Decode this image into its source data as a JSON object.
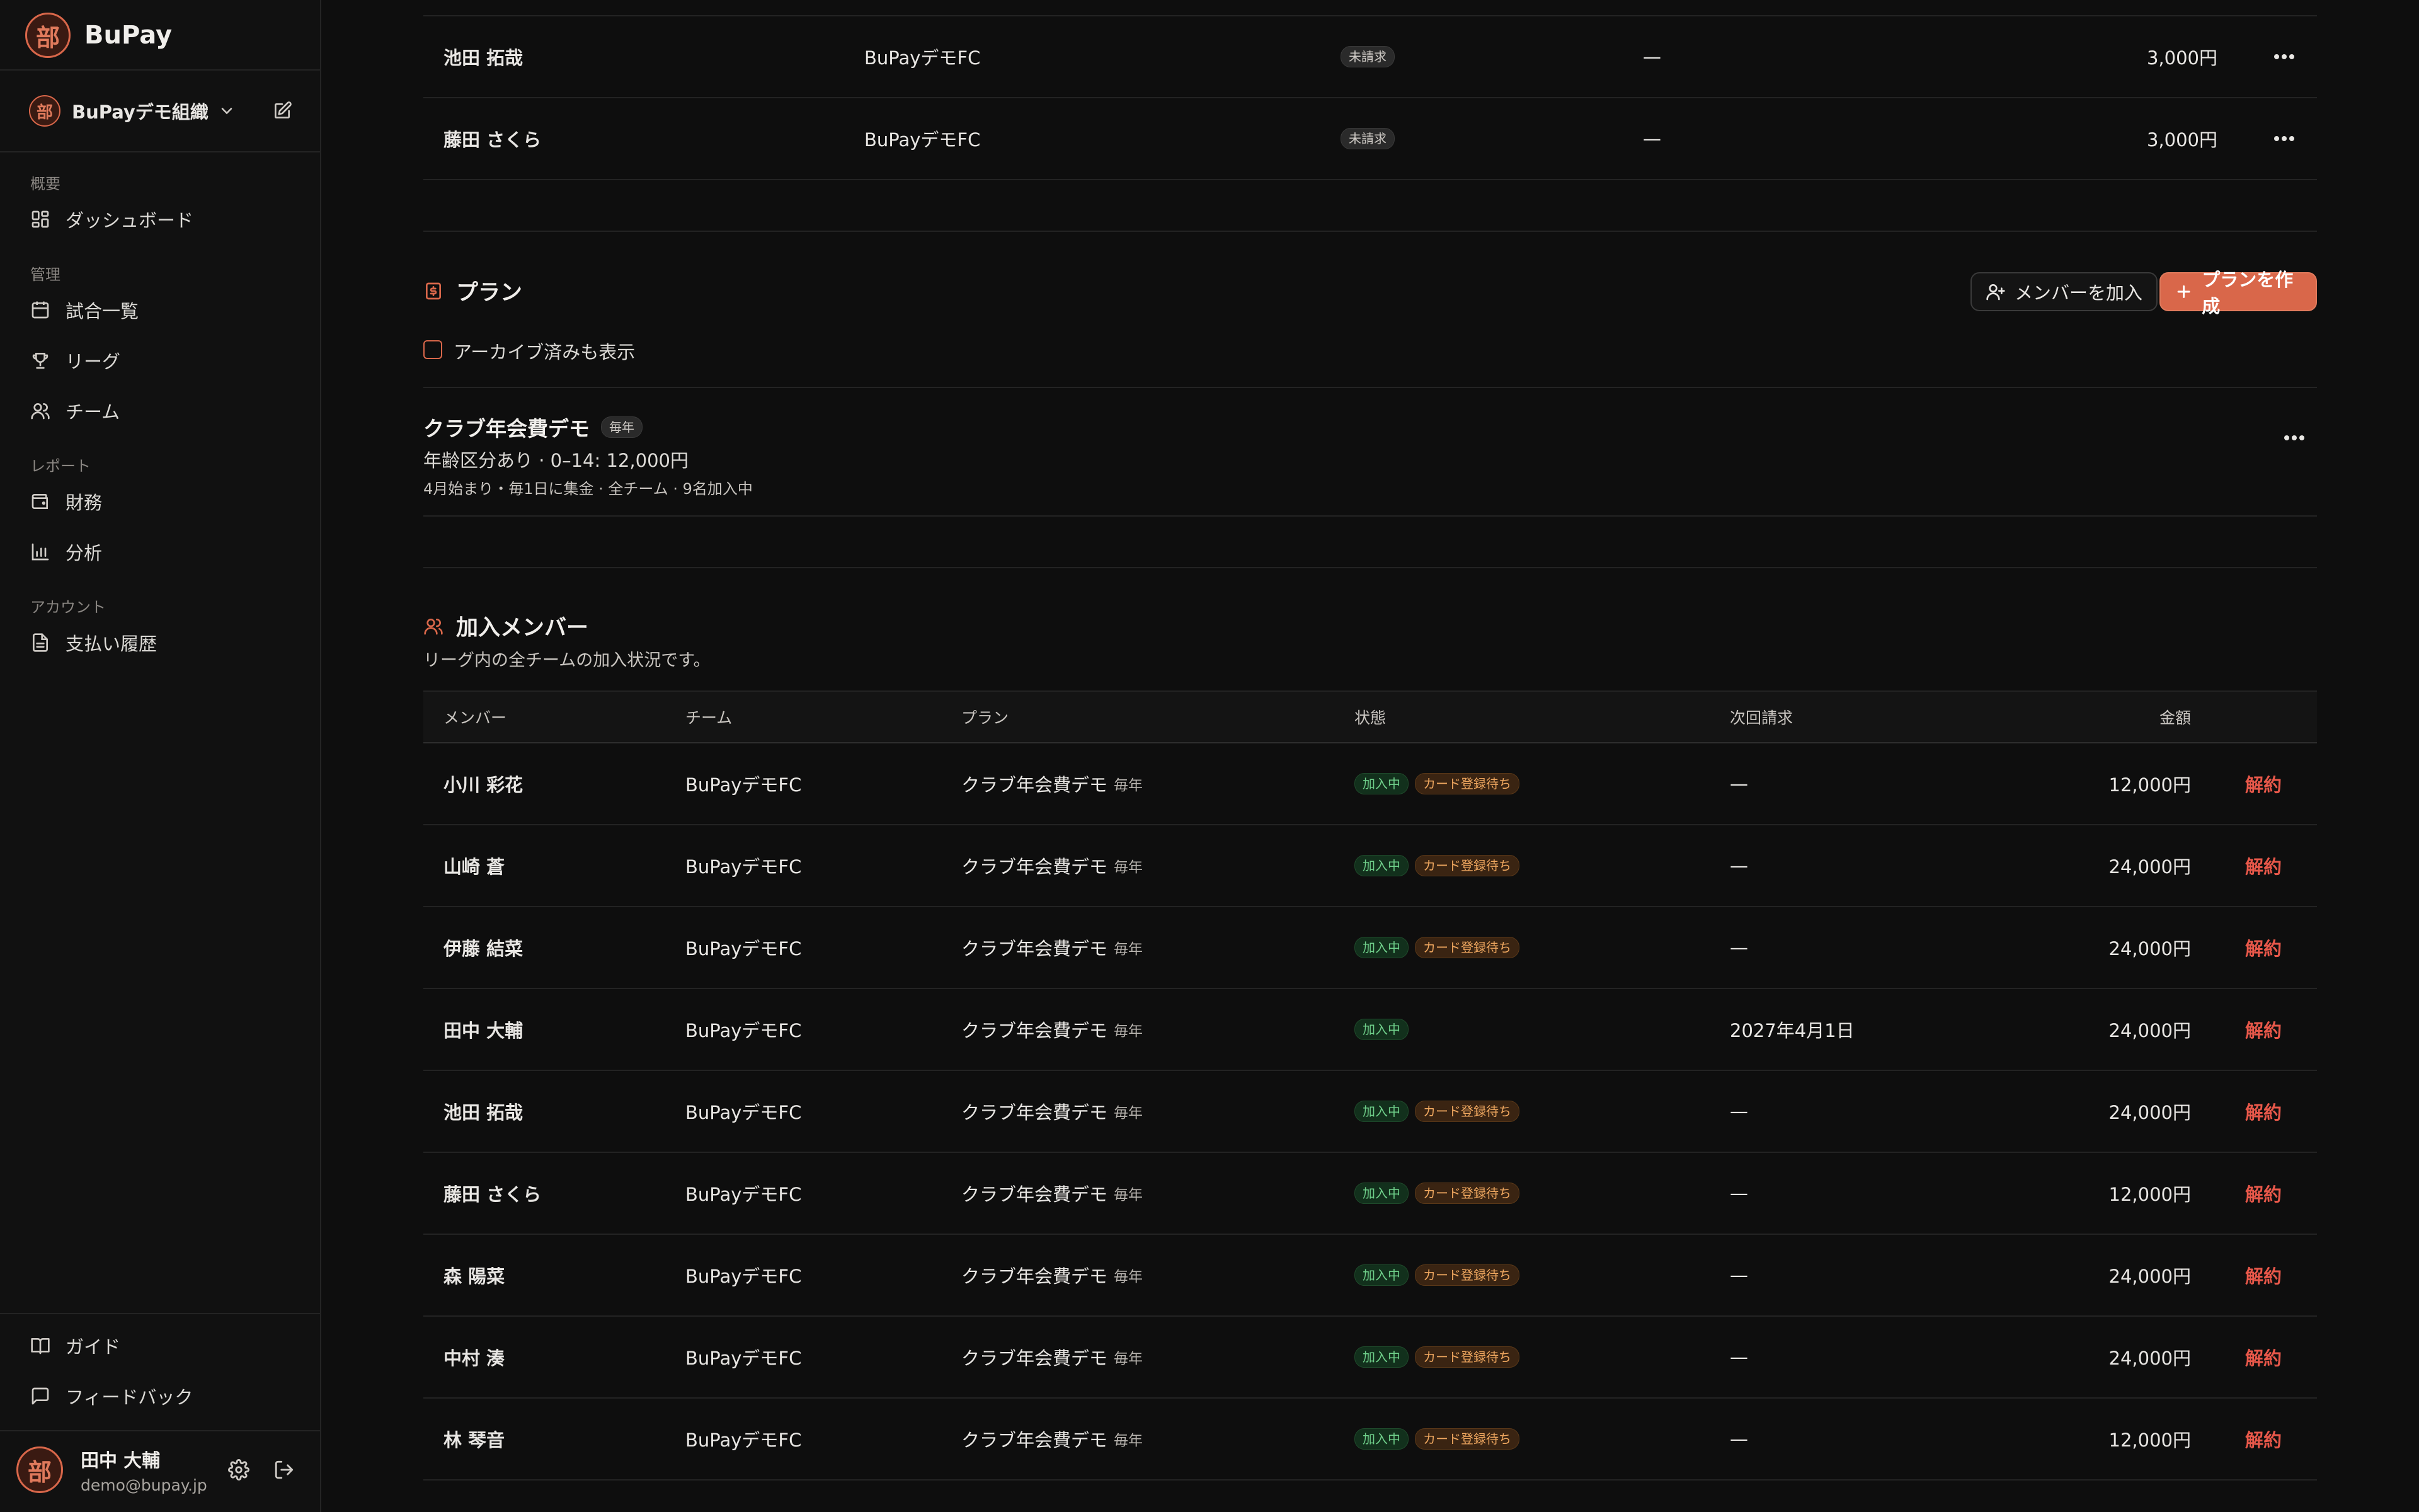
{
  "brand": {
    "name": "BuPay",
    "logo_char": "部"
  },
  "org": {
    "name": "BuPayデモ組織"
  },
  "sidebar": {
    "sections": [
      {
        "label": "概要"
      },
      {
        "label": "管理"
      },
      {
        "label": "レポート"
      },
      {
        "label": "アカウント"
      }
    ],
    "items": [
      {
        "label": "ダッシュボード",
        "icon": "dashboard-icon"
      },
      {
        "label": "試合一覧",
        "icon": "calendar-icon"
      },
      {
        "label": "リーグ",
        "icon": "trophy-icon"
      },
      {
        "label": "チーム",
        "icon": "users-icon"
      },
      {
        "label": "財務",
        "icon": "wallet-icon"
      },
      {
        "label": "分析",
        "icon": "bar-chart-icon"
      },
      {
        "label": "支払い履歴",
        "icon": "document-icon"
      }
    ],
    "footer": [
      {
        "label": "ガイド",
        "icon": "book-icon"
      },
      {
        "label": "フィードバック",
        "icon": "message-icon"
      }
    ],
    "user": {
      "name": "田中 大輔",
      "email": "demo@bupay.jp"
    }
  },
  "billing_rows": [
    {
      "name": "池田 拓哉",
      "team": "BuPayデモFC",
      "status": "未請求",
      "next": "—",
      "amount": "3,000円"
    },
    {
      "name": "藤田 さくら",
      "team": "BuPayデモFC",
      "status": "未請求",
      "next": "—",
      "amount": "3,000円"
    }
  ],
  "plans": {
    "title": "プラン",
    "add_member_label": "メンバーを加入",
    "create_plan_label": "プランを作成",
    "show_archived_label": "アーカイブ済みも表示",
    "items": [
      {
        "name": "クラブ年会費デモ",
        "frequency": "毎年",
        "price_line": "年齢区分あり · 0–14: 12,000円",
        "detail_line": "4月始まり・毎1日に集金 · 全チーム · 9名加入中"
      }
    ]
  },
  "members": {
    "title": "加入メンバー",
    "subtitle": "リーグ内の全チームの加入状況です。",
    "headers": {
      "member": "メンバー",
      "team": "チーム",
      "plan": "プラン",
      "status": "状態",
      "next": "次回請求",
      "amount": "金額"
    },
    "cancel_label": "解約",
    "rows": [
      {
        "name": "小川 彩花",
        "team": "BuPayデモFC",
        "plan": "クラブ年会費デモ",
        "freq": "毎年",
        "status": "加入中",
        "sub_status": "カード登録待ち",
        "next": "—",
        "amount": "12,000円"
      },
      {
        "name": "山崎 蒼",
        "team": "BuPayデモFC",
        "plan": "クラブ年会費デモ",
        "freq": "毎年",
        "status": "加入中",
        "sub_status": "カード登録待ち",
        "next": "—",
        "amount": "24,000円"
      },
      {
        "name": "伊藤 結菜",
        "team": "BuPayデモFC",
        "plan": "クラブ年会費デモ",
        "freq": "毎年",
        "status": "加入中",
        "sub_status": "カード登録待ち",
        "next": "—",
        "amount": "24,000円"
      },
      {
        "name": "田中 大輔",
        "team": "BuPayデモFC",
        "plan": "クラブ年会費デモ",
        "freq": "毎年",
        "status": "加入中",
        "sub_status": "",
        "next": "2027年4月1日",
        "amount": "24,000円"
      },
      {
        "name": "池田 拓哉",
        "team": "BuPayデモFC",
        "plan": "クラブ年会費デモ",
        "freq": "毎年",
        "status": "加入中",
        "sub_status": "カード登録待ち",
        "next": "—",
        "amount": "24,000円"
      },
      {
        "name": "藤田 さくら",
        "team": "BuPayデモFC",
        "plan": "クラブ年会費デモ",
        "freq": "毎年",
        "status": "加入中",
        "sub_status": "カード登録待ち",
        "next": "—",
        "amount": "12,000円"
      },
      {
        "name": "森 陽菜",
        "team": "BuPayデモFC",
        "plan": "クラブ年会費デモ",
        "freq": "毎年",
        "status": "加入中",
        "sub_status": "カード登録待ち",
        "next": "—",
        "amount": "24,000円"
      },
      {
        "name": "中村 湊",
        "team": "BuPayデモFC",
        "plan": "クラブ年会費デモ",
        "freq": "毎年",
        "status": "加入中",
        "sub_status": "カード登録待ち",
        "next": "—",
        "amount": "24,000円"
      },
      {
        "name": "林 琴音",
        "team": "BuPayデモFC",
        "plan": "クラブ年会費デモ",
        "freq": "毎年",
        "status": "加入中",
        "sub_status": "カード登録待ち",
        "next": "—",
        "amount": "12,000円"
      }
    ]
  },
  "colors": {
    "accent": "#d9674a",
    "background": "#0e0e0e",
    "sidebar": "#111111",
    "danger": "#e8584a",
    "active": "#6fcf8a",
    "pending": "#f0a860"
  }
}
